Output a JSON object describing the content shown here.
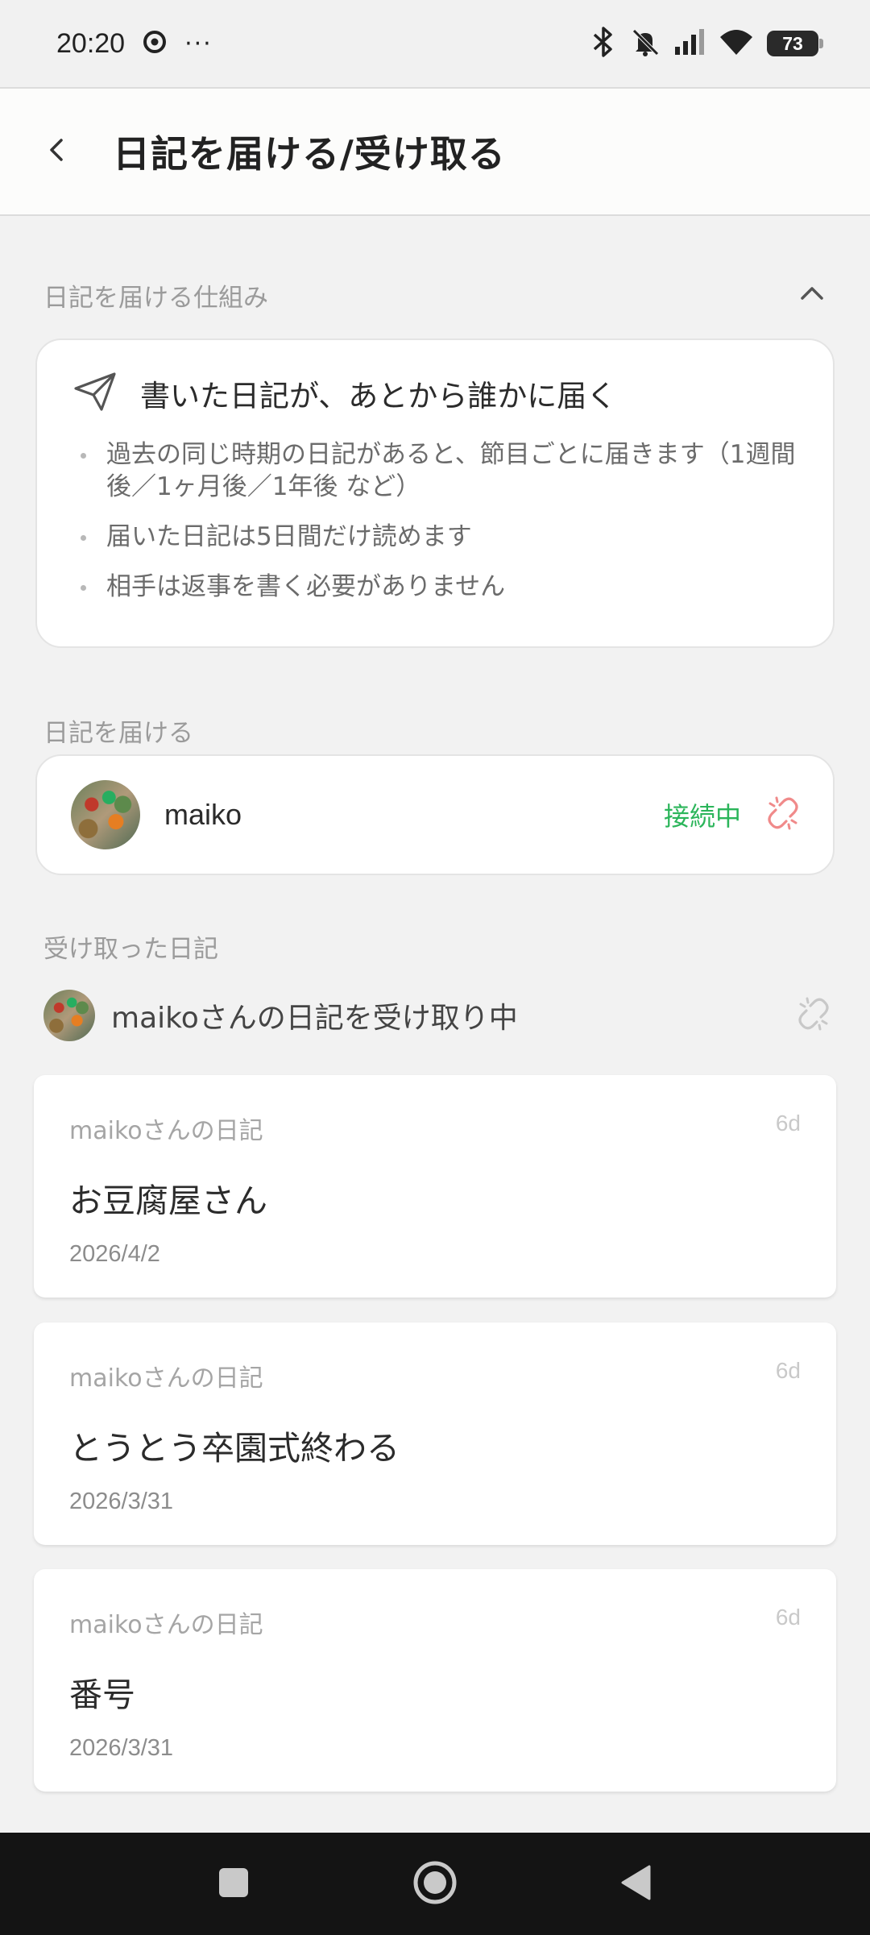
{
  "status_bar": {
    "time": "20:20",
    "battery": "73",
    "more": "···",
    "icons": [
      "chrome-icon",
      "bluetooth-icon",
      "bell-off-icon",
      "signal-icon",
      "wifi-icon",
      "battery-icon"
    ]
  },
  "header": {
    "title": "日記を届ける/受け取る",
    "back_icon": "chevron-left-icon"
  },
  "how_it_works": {
    "label": "日記を届ける仕組み",
    "title": "書いた日記が、あとから誰かに届く",
    "bullets": [
      "過去の同じ時期の日記があると、節目ごとに届きます（1週間後／1ヶ月後／1年後 など）",
      "届いた日記は5日間だけ読めます",
      "相手は返事を書く必要がありません"
    ]
  },
  "send": {
    "label": "日記を届ける",
    "name": "maiko",
    "status": "接続中",
    "status_color": "#2bb55a",
    "unlink_color": "#f08a8a"
  },
  "received": {
    "label": "受け取った日記",
    "receiving_text": "maikoさんの日記を受け取り中",
    "entries": [
      {
        "from": "maikoさんの日記",
        "age": "6d",
        "title": "お豆腐屋さん",
        "date": "2026/4/2"
      },
      {
        "from": "maikoさんの日記",
        "age": "6d",
        "title": "とうとう卒園式終わる",
        "date": "2026/3/31"
      },
      {
        "from": "maikoさんの日記",
        "age": "6d",
        "title": "番号",
        "date": "2026/3/31"
      }
    ]
  },
  "nav": {
    "icons": [
      "recents-square-icon",
      "home-circle-icon",
      "back-triangle-icon"
    ]
  }
}
